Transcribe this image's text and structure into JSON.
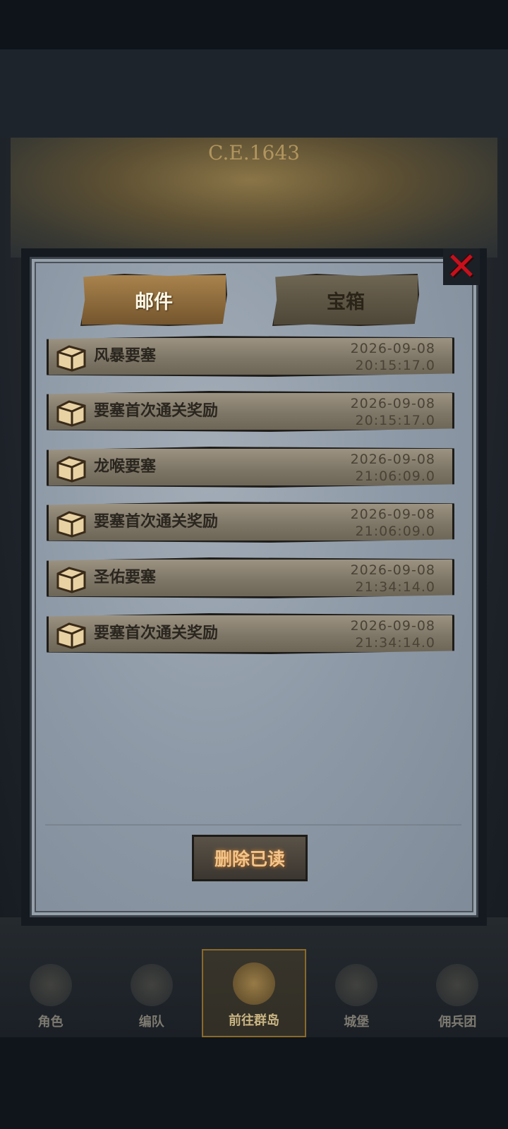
{
  "scene": {
    "era_label": "C.E.1643"
  },
  "dialog": {
    "tabs": [
      {
        "label": "邮件",
        "active": true
      },
      {
        "label": "宝箱",
        "active": false
      }
    ],
    "close_icon": "close-x-icon",
    "mails": [
      {
        "title": "风暴要塞",
        "date": "2026-09-08",
        "time": "20:15:17.0",
        "icon": "chest-icon"
      },
      {
        "title": "要塞首次通关奖励",
        "date": "2026-09-08",
        "time": "20:15:17.0",
        "icon": "chest-icon"
      },
      {
        "title": "龙喉要塞",
        "date": "2026-09-08",
        "time": "21:06:09.0",
        "icon": "chest-icon"
      },
      {
        "title": "要塞首次通关奖励",
        "date": "2026-09-08",
        "time": "21:06:09.0",
        "icon": "chest-icon"
      },
      {
        "title": "圣佑要塞",
        "date": "2026-09-08",
        "time": "21:34:14.0",
        "icon": "chest-icon"
      },
      {
        "title": "要塞首次通关奖励",
        "date": "2026-09-08",
        "time": "21:34:14.0",
        "icon": "chest-icon"
      }
    ],
    "delete_read_label": "删除已读"
  },
  "nav": {
    "items": [
      {
        "label": "角色",
        "active": false
      },
      {
        "label": "编队",
        "active": false
      },
      {
        "label": "前往群岛",
        "active": true
      },
      {
        "label": "城堡",
        "active": false
      },
      {
        "label": "佣兵团",
        "active": false
      }
    ]
  },
  "colors": {
    "close_red": "#c8101c",
    "accent_gold": "#a9834d",
    "panel_gray": "#8d99a6"
  }
}
